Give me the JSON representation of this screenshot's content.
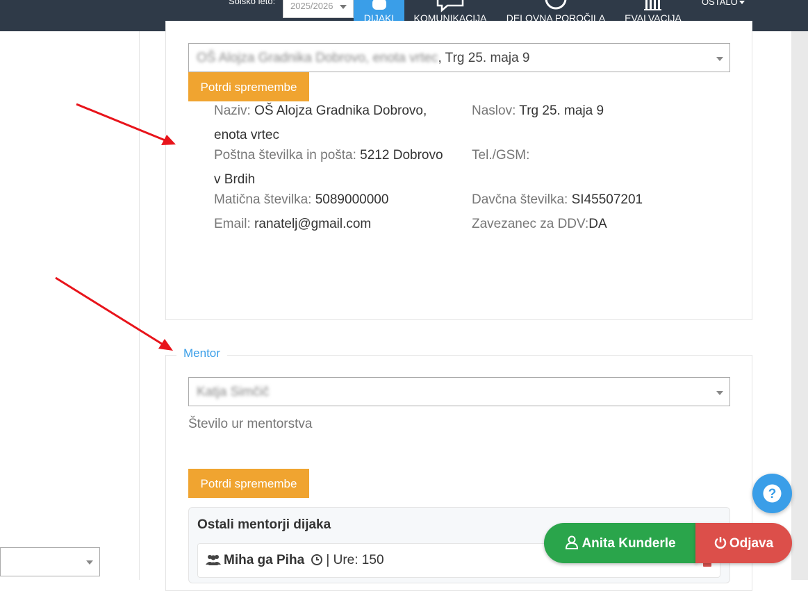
{
  "header": {
    "school_year_label": "Šolsko leto:",
    "school_year_value": "2025/2026",
    "nav": {
      "dijaki": "DIJAKI",
      "komunikacija": "KOMUNIKACIJA",
      "delovna_porocila": "DELOVNA POROČILA",
      "evalvacija": "EVALVACIJA",
      "ostalo": "OSTALO"
    }
  },
  "organization": {
    "select_name": "OŠ Alojza Gradnika Dobrovo, enota vrtec",
    "select_address": ", Trg 25. maja 9",
    "confirm_label": "Potrdi spremembe",
    "fields": {
      "naziv_label": "Naziv:",
      "naziv_value": "OŠ Alojza Gradnika Dobrovo, enota vrtec",
      "naslov_label": "Naslov:",
      "naslov_value": "Trg 25. maja 9",
      "posta_label": "Poštna številka in pošta:",
      "posta_value": "5212 Dobrovo v Brdih",
      "tel_label": "Tel./GSM:",
      "tel_value": "",
      "maticna_label": "Matična številka:",
      "maticna_value": "5089000000",
      "davcna_label": "Davčna številka:",
      "davcna_value": "SI45507201",
      "email_label": "Email:",
      "email_value": "ranatelj@gmail.com",
      "ddv_label": "Zavezanec za DDV:",
      "ddv_value": "DA"
    }
  },
  "mentor": {
    "legend": "Mentor",
    "selected": "Katja Simčič",
    "hours_label": "Število ur mentorstva",
    "confirm_label": "Potrdi spremembe",
    "others_title": "Ostali mentorji dijaka",
    "others": [
      {
        "name": "Miha ga Piha",
        "hours_text": "| Ure: 150"
      }
    ]
  },
  "footer": {
    "user_name": "Anita Kunderle",
    "logout_label": "Odjava"
  },
  "colors": {
    "nav_bg": "#2f3a48",
    "accent_blue": "#3a9ee8",
    "orange": "#f0a430",
    "green": "#2aa54b",
    "red": "#dc4f4a"
  }
}
